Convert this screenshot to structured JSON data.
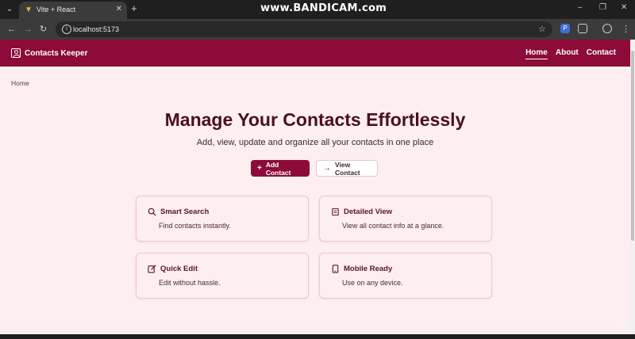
{
  "browser": {
    "tab_title": "Vite + React",
    "url": "localhost:5173",
    "watermark": "www.BANDICAM.com"
  },
  "header": {
    "brand": "Contacts Keeper",
    "nav": [
      {
        "label": "Home",
        "active": true
      },
      {
        "label": "About",
        "active": false
      },
      {
        "label": "Contact",
        "active": false
      }
    ]
  },
  "breadcrumb": "Home",
  "hero": {
    "title": "Manage Your Contacts Effortlessly",
    "subtitle": "Add, view, update and organize all your contacts in one place",
    "primary_button": "Add Contact",
    "secondary_button": "View Contact"
  },
  "features": [
    {
      "title": "Smart Search",
      "description": "Find contacts instantly.",
      "icon": "search-icon"
    },
    {
      "title": "Detailed View",
      "description": "View all contact info at a glance.",
      "icon": "scroll-icon"
    },
    {
      "title": "Quick Edit",
      "description": "Edit without hassle.",
      "icon": "edit-icon"
    },
    {
      "title": "Mobile Ready",
      "description": "Use on any device.",
      "icon": "tablet-icon"
    }
  ],
  "colors": {
    "brand": "#8c0b38",
    "background": "#fdeef0",
    "heading": "#4a1020"
  }
}
